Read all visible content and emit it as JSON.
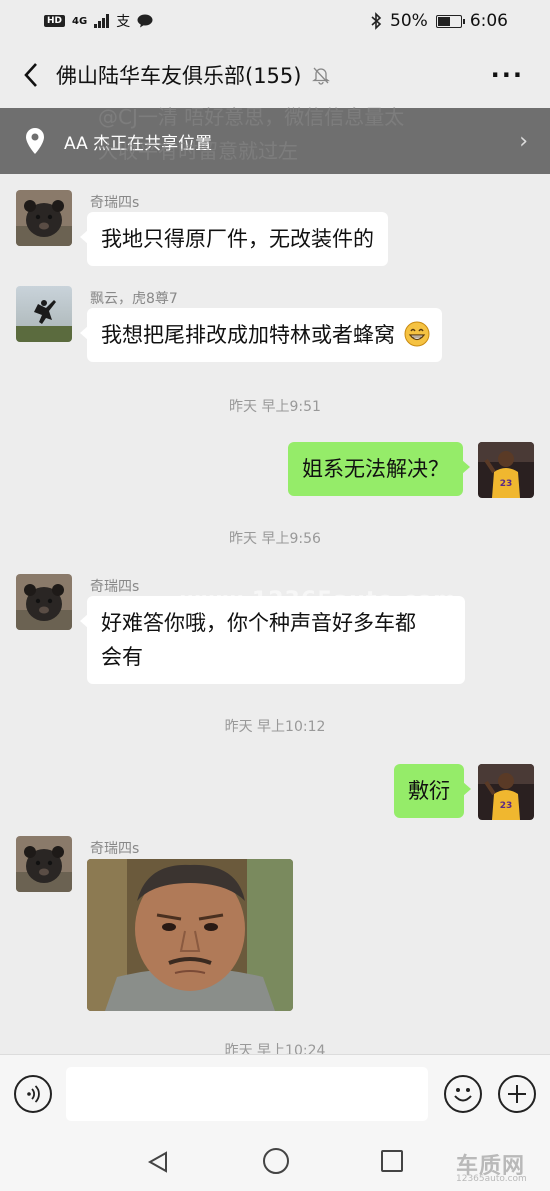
{
  "status_bar": {
    "network_badge": "HD",
    "network_type": "4G",
    "battery": "50%",
    "battery_level": 0.5,
    "time": "6:06"
  },
  "header": {
    "title": "佛山陆华车友俱乐部(155)"
  },
  "location_banner": {
    "text": "AA 杰正在共享位置",
    "ghost_text_1": "@CJ一清  唔好意思，微信信息量太",
    "ghost_text_2": "大收平有时留意就过左"
  },
  "messages": [
    {
      "sender": "奇瑞四s",
      "text": "我地只得原厂件，无改装件的"
    },
    {
      "sender": "飘云，虎8尊7",
      "text": "我想把尾排改成加特林或者蜂窝"
    },
    {
      "timestamp": "昨天 早上9:51"
    },
    {
      "text": "姐系无法解决？"
    },
    {
      "timestamp": "昨天 早上9:56"
    },
    {
      "sender": "奇瑞四s",
      "text_line1": "好难答你哦，你个种声音好多车都",
      "text_line2": "会有"
    },
    {
      "timestamp": "昨天 早上10:12"
    },
    {
      "text": "敷衍"
    },
    {
      "sender": "奇瑞四s"
    },
    {
      "timestamp": "昨天 早上10:24"
    }
  ],
  "watermark": "www.12365auto.com",
  "brand": {
    "logo": "车质网",
    "url": "12365auto.com"
  },
  "colors": {
    "bubble_self": "#95ec69",
    "bubble_other": "#ffffff",
    "background": "#ededed",
    "banner": "#6f6f6f"
  }
}
